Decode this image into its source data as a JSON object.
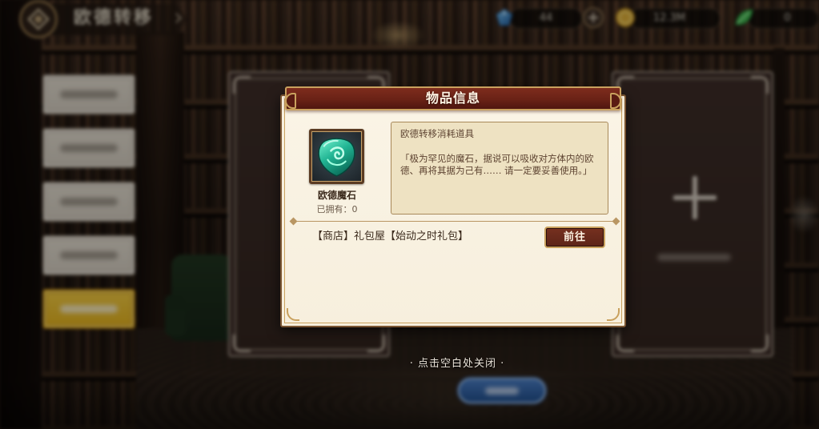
{
  "top_bar": {
    "title": "欧德转移",
    "menu_icon": "diamond-emblem-icon",
    "dropdown_icon": "chevron-right-icon",
    "add_button_icon": "plus-icon",
    "resources": [
      {
        "icon": "blue-gem-icon",
        "value": "44"
      },
      {
        "icon": "gold-coin-icon",
        "value": "12.3M"
      },
      {
        "icon": "green-leaf-gem-icon",
        "value": "0"
      }
    ]
  },
  "slots": {
    "right_slot_icon": "plus-icon"
  },
  "close_hint": "· 点击空白处关闭 ·",
  "modal": {
    "title": "物品信息",
    "item": {
      "icon": "green-magic-stone-icon",
      "name": "欧德魔石",
      "owned": "已拥有：0"
    },
    "description": {
      "category": "欧德转移消耗道具",
      "flavor_lines": [
        "「极为罕见的魔石，据说可以吸收对方体内的欧",
        "德、再将其据为己有…… 请一定要妥善使用。」"
      ]
    },
    "source": {
      "text": "【商店】礼包屋【始动之时礼包】",
      "go_button": "前往"
    }
  },
  "colors": {
    "scene-base": "#1d140f",
    "modal-body": "#f7efdd",
    "modal-border": "#7a5532",
    "gold": "#c9a15e",
    "header": "#6a2216",
    "desc-box": "#eee2c2",
    "go-button": "#5c2418",
    "sidebar-item": "#d8d1c4",
    "sidebar-active": "#e8b51e"
  }
}
